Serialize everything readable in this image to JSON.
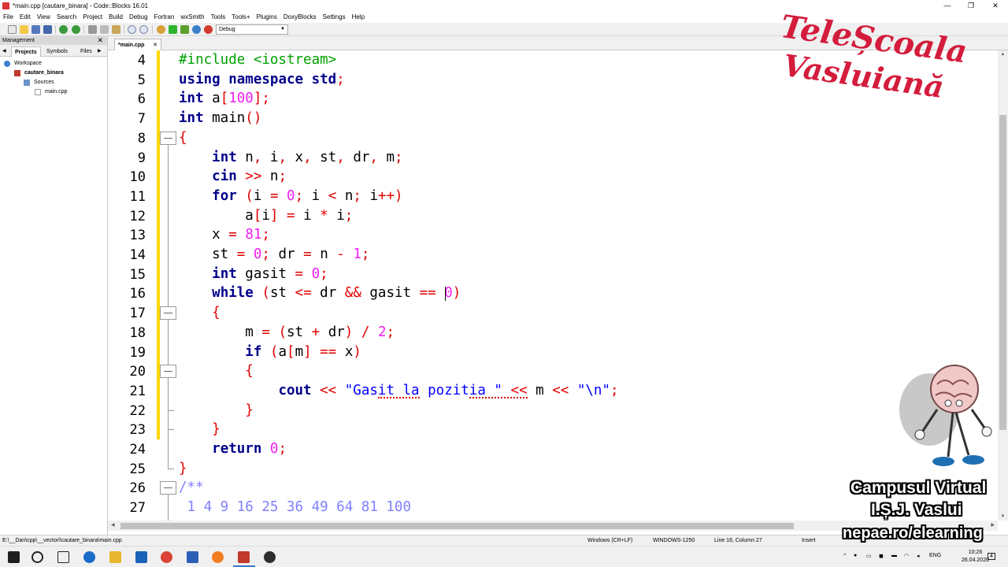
{
  "window": {
    "title": "*main.cpp [cautare_binara] - Code::Blocks 16.01",
    "minimize": "—",
    "maximize": "❐",
    "close": "✕"
  },
  "menu": [
    "File",
    "Edit",
    "View",
    "Search",
    "Project",
    "Build",
    "Debug",
    "Fortran",
    "wxSmith",
    "Tools",
    "Tools+",
    "Plugins",
    "DoxyBlocks",
    "Settings",
    "Help"
  ],
  "toolbar": {
    "build_target": "Debug"
  },
  "management": {
    "title": "Management",
    "close": "✕",
    "tabs": [
      "Projects",
      "Symbols",
      "Files"
    ],
    "tree": {
      "workspace": "Workspace",
      "project": "cautare_binara",
      "folder": "Sources",
      "file": "main.cpp"
    }
  },
  "editor": {
    "tab_label": "*main.cpp",
    "tab_close": "✕",
    "line_numbers": [
      "4",
      "5",
      "6",
      "7",
      "8",
      "9",
      "10",
      "11",
      "12",
      "13",
      "14",
      "15",
      "16",
      "17",
      "18",
      "19",
      "20",
      "21",
      "22",
      "23",
      "24",
      "25",
      "26",
      "27"
    ],
    "lines": [
      [
        [
          "pre",
          "#include <iostream>"
        ]
      ],
      [
        [
          "kw",
          "using"
        ],
        [
          "plain",
          " "
        ],
        [
          "kw",
          "namespace"
        ],
        [
          "plain",
          " "
        ],
        [
          "kw",
          "std"
        ],
        [
          "op",
          ";"
        ]
      ],
      [
        [
          "kw",
          "int"
        ],
        [
          "plain",
          " a"
        ],
        [
          "op",
          "["
        ],
        [
          "num",
          "100"
        ],
        [
          "op",
          "];"
        ]
      ],
      [
        [
          "kw",
          "int"
        ],
        [
          "plain",
          " main"
        ],
        [
          "op",
          "()"
        ]
      ],
      [
        [
          "op",
          "{"
        ]
      ],
      [
        [
          "plain",
          "    "
        ],
        [
          "kw",
          "int"
        ],
        [
          "plain",
          " n"
        ],
        [
          "op",
          ","
        ],
        [
          "plain",
          " i"
        ],
        [
          "op",
          ","
        ],
        [
          "plain",
          " x"
        ],
        [
          "op",
          ","
        ],
        [
          "plain",
          " st"
        ],
        [
          "op",
          ","
        ],
        [
          "plain",
          " dr"
        ],
        [
          "op",
          ","
        ],
        [
          "plain",
          " m"
        ],
        [
          "op",
          ";"
        ]
      ],
      [
        [
          "plain",
          "    "
        ],
        [
          "kw",
          "cin"
        ],
        [
          "plain",
          " "
        ],
        [
          "op",
          ">>"
        ],
        [
          "plain",
          " n"
        ],
        [
          "op",
          ";"
        ]
      ],
      [
        [
          "plain",
          "    "
        ],
        [
          "kw",
          "for"
        ],
        [
          "plain",
          " "
        ],
        [
          "op",
          "("
        ],
        [
          "plain",
          "i "
        ],
        [
          "op",
          "="
        ],
        [
          "plain",
          " "
        ],
        [
          "num",
          "0"
        ],
        [
          "op",
          ";"
        ],
        [
          "plain",
          " i "
        ],
        [
          "op",
          "<"
        ],
        [
          "plain",
          " n"
        ],
        [
          "op",
          ";"
        ],
        [
          "plain",
          " i"
        ],
        [
          "op",
          "++)"
        ]
      ],
      [
        [
          "plain",
          "        a"
        ],
        [
          "op",
          "["
        ],
        [
          "plain",
          "i"
        ],
        [
          "op",
          "]"
        ],
        [
          "plain",
          " "
        ],
        [
          "op",
          "="
        ],
        [
          "plain",
          " i "
        ],
        [
          "op",
          "*"
        ],
        [
          "plain",
          " i"
        ],
        [
          "op",
          ";"
        ]
      ],
      [
        [
          "plain",
          "    x "
        ],
        [
          "op",
          "="
        ],
        [
          "plain",
          " "
        ],
        [
          "num",
          "81"
        ],
        [
          "op",
          ";"
        ]
      ],
      [
        [
          "plain",
          "    st "
        ],
        [
          "op",
          "="
        ],
        [
          "plain",
          " "
        ],
        [
          "num",
          "0"
        ],
        [
          "op",
          ";"
        ],
        [
          "plain",
          " dr "
        ],
        [
          "op",
          "="
        ],
        [
          "plain",
          " n "
        ],
        [
          "op",
          "-"
        ],
        [
          "plain",
          " "
        ],
        [
          "num",
          "1"
        ],
        [
          "op",
          ";"
        ]
      ],
      [
        [
          "plain",
          "    "
        ],
        [
          "kw",
          "int"
        ],
        [
          "plain",
          " gasit "
        ],
        [
          "op",
          "="
        ],
        [
          "plain",
          " "
        ],
        [
          "num",
          "0"
        ],
        [
          "op",
          ";"
        ]
      ],
      [
        [
          "plain",
          "    "
        ],
        [
          "kw",
          "while"
        ],
        [
          "plain",
          " "
        ],
        [
          "op",
          "("
        ],
        [
          "plain",
          "st "
        ],
        [
          "op",
          "<="
        ],
        [
          "plain",
          " dr "
        ],
        [
          "op",
          "&&"
        ],
        [
          "plain",
          " gasit "
        ],
        [
          "op",
          "=="
        ],
        [
          "plain",
          " "
        ],
        [
          "num",
          "0"
        ],
        [
          "op",
          ")"
        ]
      ],
      [
        [
          "plain",
          "    "
        ],
        [
          "op",
          "{"
        ]
      ],
      [
        [
          "plain",
          "        m "
        ],
        [
          "op",
          "="
        ],
        [
          "plain",
          " "
        ],
        [
          "op",
          "("
        ],
        [
          "plain",
          "st "
        ],
        [
          "op",
          "+"
        ],
        [
          "plain",
          " dr"
        ],
        [
          "op",
          ")"
        ],
        [
          "plain",
          " "
        ],
        [
          "op",
          "/"
        ],
        [
          "plain",
          " "
        ],
        [
          "num",
          "2"
        ],
        [
          "op",
          ";"
        ]
      ],
      [
        [
          "plain",
          "        "
        ],
        [
          "kw",
          "if"
        ],
        [
          "plain",
          " "
        ],
        [
          "op",
          "("
        ],
        [
          "plain",
          "a"
        ],
        [
          "op",
          "["
        ],
        [
          "plain",
          "m"
        ],
        [
          "op",
          "]"
        ],
        [
          "plain",
          " "
        ],
        [
          "op",
          "=="
        ],
        [
          "plain",
          " x"
        ],
        [
          "op",
          ")"
        ]
      ],
      [
        [
          "plain",
          "        "
        ],
        [
          "op",
          "{"
        ]
      ],
      [
        [
          "plain",
          "            "
        ],
        [
          "kw",
          "cout"
        ],
        [
          "plain",
          " "
        ],
        [
          "op",
          "<<"
        ],
        [
          "plain",
          " "
        ],
        [
          "str",
          "\"Gasit la pozitia \""
        ],
        [
          "plain",
          " "
        ],
        [
          "op",
          "<<"
        ],
        [
          "plain",
          " m "
        ],
        [
          "op",
          "<<"
        ],
        [
          "plain",
          " "
        ],
        [
          "str",
          "\"\\n\""
        ],
        [
          "op",
          ";"
        ]
      ],
      [
        [
          "plain",
          "        "
        ],
        [
          "op",
          "}"
        ]
      ],
      [
        [
          "plain",
          "    "
        ],
        [
          "op",
          "}"
        ]
      ],
      [
        [
          "plain",
          "    "
        ],
        [
          "kw",
          "return"
        ],
        [
          "plain",
          " "
        ],
        [
          "num",
          "0"
        ],
        [
          "op",
          ";"
        ]
      ],
      [
        [
          "op",
          "}"
        ]
      ],
      [
        [
          "com",
          "/**"
        ]
      ],
      [
        [
          "com",
          " 1 4 9 16 25 36 49 64 81 100"
        ]
      ]
    ]
  },
  "statusbar": {
    "path": "E:\\__Dan\\cpp\\__vectori\\cautare_binara\\main.cpp",
    "eol": "Windows (CR+LF)",
    "encoding": "WINDOWS-1250",
    "position": "Line 16, Column 27",
    "mode": "Insert"
  },
  "taskbar": {
    "lang": "ENG",
    "time": "10:26",
    "date": "26.04.2020",
    "notif": "4"
  },
  "watermark": {
    "line1": "TeleȘcoala",
    "line2": "Vasluiană"
  },
  "badge": {
    "line1": "Campusul Virtual",
    "line2": "I.Ș.J. Vaslui",
    "line3": "nepae.ro/elearning"
  },
  "colors": {
    "keyword": "#00008b",
    "preprocessor": "#00a000",
    "number": "#f020f0",
    "operator": "#e00000",
    "string": "#0000ff",
    "comment": "#8080ff",
    "changebar": "#ffd700",
    "watermark": "#d41c3c"
  }
}
